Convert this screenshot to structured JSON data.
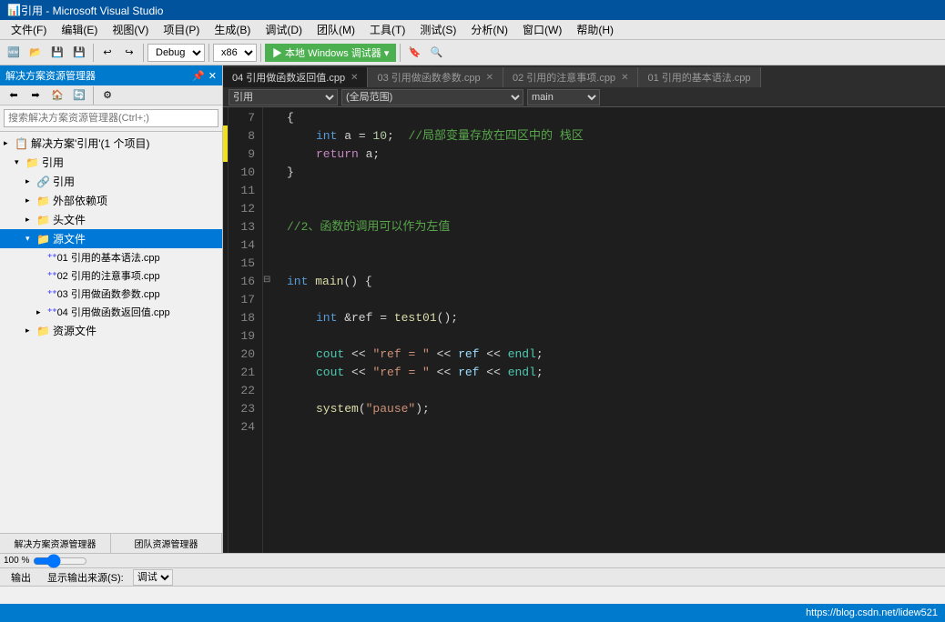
{
  "titleBar": {
    "title": "引用 - Microsoft Visual Studio",
    "icon": "⬛"
  },
  "menuBar": {
    "items": [
      {
        "label": "文件(F)"
      },
      {
        "label": "编辑(E)"
      },
      {
        "label": "视图(V)"
      },
      {
        "label": "项目(P)"
      },
      {
        "label": "生成(B)"
      },
      {
        "label": "调试(D)"
      },
      {
        "label": "团队(M)"
      },
      {
        "label": "工具(T)"
      },
      {
        "label": "测试(S)"
      },
      {
        "label": "分析(N)"
      },
      {
        "label": "窗口(W)"
      },
      {
        "label": "帮助(H)"
      }
    ]
  },
  "toolbar": {
    "debug_config": "Debug",
    "platform": "x86",
    "run_label": "▶ 本地 Windows 调试器 ▾"
  },
  "sidebar": {
    "header": "解决方案资源管理器",
    "search_placeholder": "搜索解决方案资源管理器(Ctrl+;)",
    "tabs": [
      "解决方案资源管理器",
      "团队资源管理器"
    ],
    "tree": [
      {
        "label": "解决方案'引用'(1 个项目)",
        "indent": 0,
        "arrow": "▸",
        "icon": "📋"
      },
      {
        "label": "引用",
        "indent": 1,
        "arrow": "▾",
        "icon": "📁"
      },
      {
        "label": "引用",
        "indent": 2,
        "arrow": "▸",
        "icon": ""
      },
      {
        "label": "外部依赖项",
        "indent": 2,
        "arrow": "▸",
        "icon": "📁"
      },
      {
        "label": "头文件",
        "indent": 2,
        "arrow": "▸",
        "icon": "📁"
      },
      {
        "label": "源文件",
        "indent": 2,
        "arrow": "▾",
        "icon": "📁",
        "selected": true
      },
      {
        "label": "01 引用的基本语法.cpp",
        "indent": 3,
        "arrow": "",
        "icon": "++",
        "cpp": true
      },
      {
        "label": "02 引用的注意事项.cpp",
        "indent": 3,
        "arrow": "",
        "icon": "++",
        "cpp": true
      },
      {
        "label": "03 引用做函数参数.cpp",
        "indent": 3,
        "arrow": "",
        "icon": "++",
        "cpp": true
      },
      {
        "label": "04 引用做函数返回值.cpp",
        "indent": 3,
        "arrow": "▸",
        "icon": "++",
        "cpp": true
      },
      {
        "label": "资源文件",
        "indent": 2,
        "arrow": "▸",
        "icon": "📁"
      }
    ]
  },
  "editor": {
    "tabs": [
      {
        "label": "04 引用做函数返回值.cpp",
        "active": true
      },
      {
        "label": "03 引用做函数参数.cpp",
        "active": false
      },
      {
        "label": "02 引用的注意事项.cpp",
        "active": false
      },
      {
        "label": "01 引用的基本语法.cpp",
        "active": false
      }
    ],
    "code_context": "引用",
    "scope": "(全局范围)",
    "lines": [
      {
        "num": 7,
        "content": "{",
        "collapse": false
      },
      {
        "num": 8,
        "content": "    int a = 10;  //局部变量存放在四区中的 栈区",
        "collapse": false
      },
      {
        "num": 9,
        "content": "    return a;",
        "collapse": false
      },
      {
        "num": 10,
        "content": "}",
        "collapse": false
      },
      {
        "num": 11,
        "content": "",
        "collapse": false
      },
      {
        "num": 12,
        "content": "",
        "collapse": false
      },
      {
        "num": 13,
        "content": "//2、函数的调用可以作为左值",
        "collapse": false
      },
      {
        "num": 14,
        "content": "",
        "collapse": false
      },
      {
        "num": 15,
        "content": "",
        "collapse": false
      },
      {
        "num": 16,
        "content": "int main() {",
        "collapse": true
      },
      {
        "num": 17,
        "content": "",
        "collapse": false
      },
      {
        "num": 18,
        "content": "    int &ref = test01();",
        "collapse": false
      },
      {
        "num": 19,
        "content": "",
        "collapse": false
      },
      {
        "num": 20,
        "content": "    cout << \"ref = \" << ref << endl;",
        "collapse": false
      },
      {
        "num": 21,
        "content": "    cout << \"ref = \" << ref << endl;",
        "collapse": false
      },
      {
        "num": 22,
        "content": "",
        "collapse": false
      },
      {
        "num": 23,
        "content": "    system(\"pause\");",
        "collapse": false
      },
      {
        "num": 24,
        "content": "",
        "collapse": false
      }
    ]
  },
  "statusBar": {
    "url": "https://blog.csdn.net/lidew521"
  },
  "outputPanel": {
    "tabs": [
      "输出",
      "显示输出来源(S):",
      "调试"
    ],
    "content": "显示输出来源(S): 调试"
  },
  "zoomLevel": "100 %"
}
